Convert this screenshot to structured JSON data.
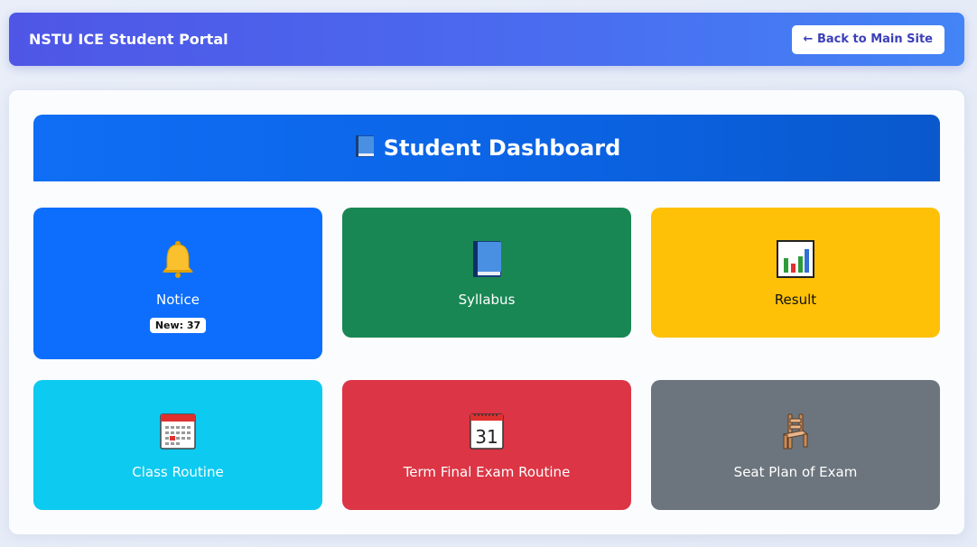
{
  "topbar": {
    "brand": "NSTU ICE Student Portal",
    "back_label": "← Back to Main Site"
  },
  "dashboard": {
    "title": "Student Dashboard",
    "title_icon": "blue-book-icon"
  },
  "cards": [
    {
      "label": "Notice",
      "icon": "bell-icon",
      "badge": "New: 37",
      "color": "#0d6efd"
    },
    {
      "label": "Syllabus",
      "icon": "book-icon",
      "color": "#198754"
    },
    {
      "label": "Result",
      "icon": "bar-chart-icon",
      "color": "#ffc107"
    },
    {
      "label": "Class Routine",
      "icon": "calendar-icon",
      "color": "#0dcaf0"
    },
    {
      "label": "Term Final Exam Routine",
      "icon": "date-calendar-icon",
      "date_text": "31",
      "color": "#dc3545"
    },
    {
      "label": "Seat Plan of Exam",
      "icon": "chair-icon",
      "color": "#6c757d"
    }
  ]
}
